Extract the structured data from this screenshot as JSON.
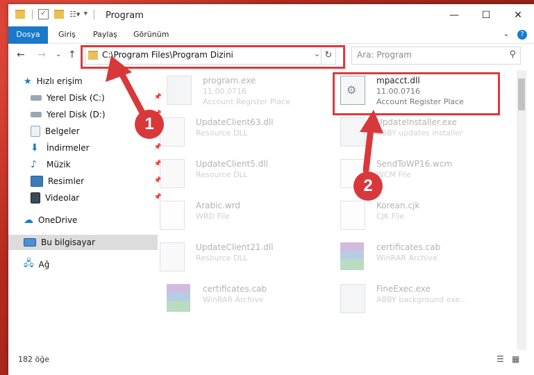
{
  "window": {
    "title": "Program"
  },
  "ribbon": {
    "tabs": [
      "Dosya",
      "Giriş",
      "Paylaş",
      "Görünüm"
    ]
  },
  "nav": {
    "address_path": "C:\\Program Files\\Program Dizini",
    "search_placeholder": "Ara: Program"
  },
  "sidebar": {
    "quick_access": "Hızlı erişim",
    "items": [
      {
        "label": "Yerel Disk (C:)",
        "icon": "drive-icon",
        "pinned": true
      },
      {
        "label": "Yerel Disk (D:)",
        "icon": "drive-icon",
        "pinned": true
      },
      {
        "label": "Belgeler",
        "icon": "documents-icon",
        "pinned": true
      },
      {
        "label": "İndirmeler",
        "icon": "download-icon",
        "pinned": true
      },
      {
        "label": "Müzik",
        "icon": "music-icon",
        "pinned": true
      },
      {
        "label": "Resimler",
        "icon": "pictures-icon",
        "pinned": true
      },
      {
        "label": "Videolar",
        "icon": "videos-icon",
        "pinned": true
      }
    ],
    "onedrive": "OneDrive",
    "this_pc": "Bu bilgisayar",
    "network": "Ağ"
  },
  "files": [
    {
      "name": "program.exe",
      "line1": "11.00.0716",
      "line2": "Account Register Place",
      "icon": "exe-icon",
      "faded": true
    },
    {
      "name": "mpacct.dll",
      "line1": "11.00.0716",
      "line2": "Account Register Place",
      "icon": "dll-gear-icon",
      "faded": false
    },
    {
      "name": "UpdateClient63.dll",
      "line1": "Resource DLL",
      "line2": "",
      "icon": "dll-icon",
      "faded": true
    },
    {
      "name": "UpdateInstaller.exe",
      "line1": "ABBY updates installer",
      "line2": "",
      "icon": "exe-icon",
      "faded": true
    },
    {
      "name": "UpdateClient5.dll",
      "line1": "Resource DLL",
      "line2": "",
      "icon": "dll-icon",
      "faded": true
    },
    {
      "name": "SendToWP16.wcm",
      "line1": "WCM File",
      "line2": "",
      "icon": "file-icon",
      "faded": true
    },
    {
      "name": "Arabic.wrd",
      "line1": "WRD File",
      "line2": "",
      "icon": "file-icon",
      "faded": true
    },
    {
      "name": "Korean.cjk",
      "line1": "CJK File",
      "line2": "",
      "icon": "file-icon",
      "faded": true
    },
    {
      "name": "UpdateClient21.dll",
      "line1": "Resource DLL",
      "line2": "",
      "icon": "dll-icon",
      "faded": true
    },
    {
      "name": "certificates.cab",
      "line1": "WinRAR Archive",
      "line2": "",
      "icon": "rar-icon",
      "faded": true
    },
    {
      "name": "certificates.cab",
      "line1": "WinRAR Archive",
      "line2": "",
      "icon": "rar-icon",
      "faded": true
    },
    {
      "name": "FineExec.exe",
      "line1": "ABBY background exe...",
      "line2": "",
      "icon": "exe-icon",
      "faded": true
    }
  ],
  "status": {
    "count": "182 öğe"
  },
  "callouts": [
    "1",
    "2"
  ],
  "colors": {
    "accent": "#1979ca",
    "highlight": "#e0393e"
  }
}
